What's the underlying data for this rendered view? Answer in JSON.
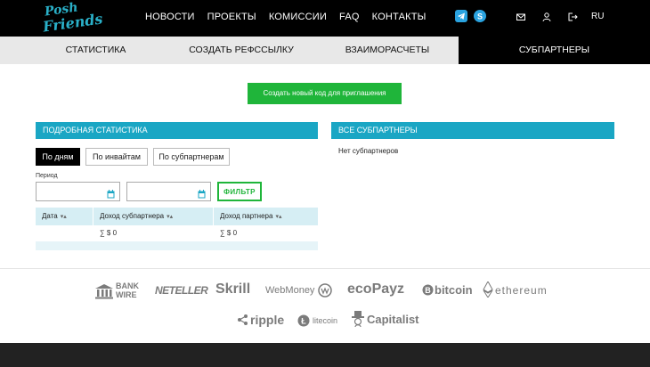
{
  "brand": {
    "line1": "Posh",
    "line2": "Friends"
  },
  "nav": {
    "items": [
      "НОВОСТИ",
      "ПРОЕКТЫ",
      "КОМИССИИ",
      "FAQ",
      "КОНТАКТЫ"
    ]
  },
  "header": {
    "lang": "RU",
    "icons": [
      "telegram-icon",
      "skype-icon",
      "mail-icon",
      "user-icon",
      "logout-icon"
    ]
  },
  "tabs": [
    {
      "label": "СТАТИСТИКА",
      "active": false
    },
    {
      "label": "СОЗДАТЬ РЕФССЫЛКУ",
      "active": false
    },
    {
      "label": "ВЗАИМОРАСЧЕТЫ",
      "active": false
    },
    {
      "label": "СУБПАРТНЕРЫ",
      "active": true
    }
  ],
  "create_button": "Создать новый код для приглашения",
  "stats": {
    "title": "ПОДРОБНАЯ СТАТИСТИКА",
    "group_buttons": [
      "По дням",
      "По инвайтам",
      "По субпартнерам"
    ],
    "period_label": "Период",
    "filter_button": "ФИЛЬТР",
    "columns": [
      "Дата",
      "Доход субпартнера",
      "Доход партнера"
    ],
    "totals": [
      "∑ $ 0",
      "∑ $ 0"
    ]
  },
  "subpartners": {
    "title": "ВСЕ СУБПАРТНЕРЫ",
    "empty_text": "Нет субпартнеров"
  },
  "payments": {
    "bankwire_1": "BANK",
    "bankwire_2": "WIRE",
    "neteller": "NETELLER",
    "skrill": "Skrill",
    "webmoney": "WebMoney",
    "ecopayz": "ecoPayz",
    "bitcoin": "bitcoin",
    "ethereum": "ethereum",
    "ripple": "ripple",
    "litecoin": "litecoin",
    "capitalist": "Capitalist"
  },
  "colors": {
    "accent": "#1aa6c4",
    "green": "#1fb53a",
    "topbar": "#000000"
  }
}
